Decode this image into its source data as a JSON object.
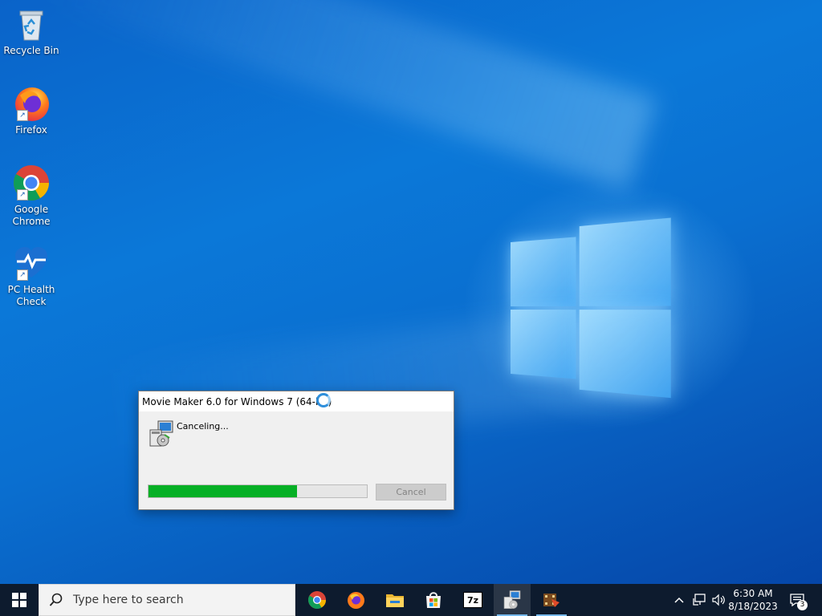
{
  "desktop": {
    "icons": [
      {
        "label": "Recycle Bin",
        "icon": "recycle-bin-icon"
      },
      {
        "label": "Firefox",
        "icon": "firefox-icon"
      },
      {
        "label": "Google Chrome",
        "icon": "chrome-icon"
      },
      {
        "label": "PC Health Check",
        "icon": "pc-health-check-icon"
      }
    ]
  },
  "dialog": {
    "title": "Movie Maker 6.0 for Windows 7 (64-bit)",
    "status": "Canceling...",
    "progress": 0.68,
    "cancel_label": "Cancel",
    "cancel_enabled": false
  },
  "taskbar": {
    "search_placeholder": "Type here to search",
    "apps": [
      {
        "name": "Google Chrome",
        "icon": "chrome-icon"
      },
      {
        "name": "Firefox",
        "icon": "firefox-icon"
      },
      {
        "name": "File Explorer",
        "icon": "folder-icon"
      },
      {
        "name": "Microsoft Store",
        "icon": "store-icon"
      },
      {
        "name": "7-Zip",
        "icon": "7zip-icon",
        "glyph": "7z"
      },
      {
        "name": "Movie Maker Setup",
        "icon": "setup-icon"
      },
      {
        "name": "Movie Maker",
        "icon": "movie-maker-icon"
      }
    ],
    "time": "6:30 AM",
    "date": "8/18/2023",
    "notification_count": "3"
  },
  "colors": {
    "progress_fill": "#06b025",
    "taskbar_bg": "#0d1b2e",
    "accent": "#76b9ed"
  }
}
